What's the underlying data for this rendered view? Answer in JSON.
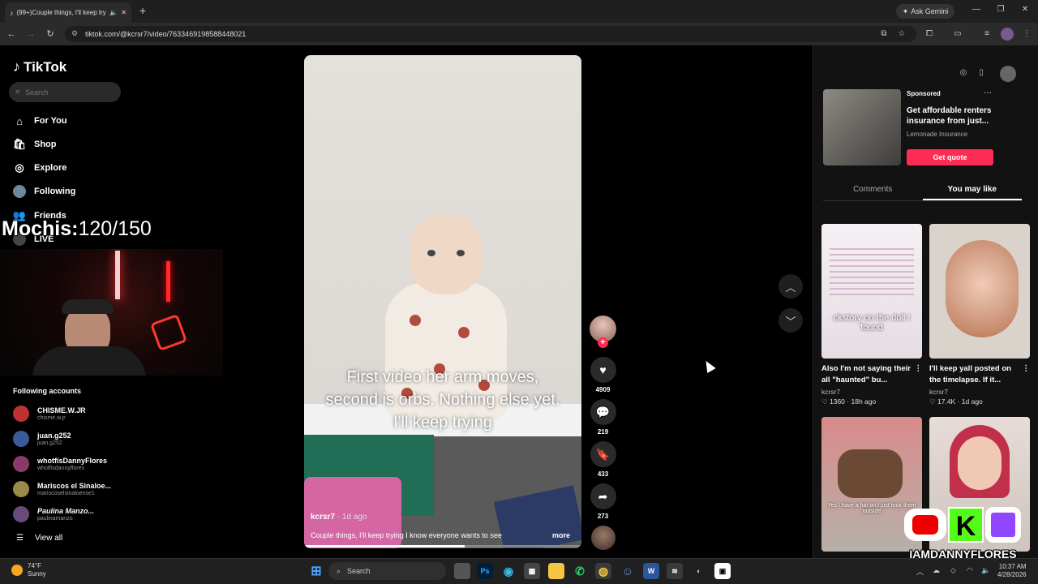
{
  "browser": {
    "tab_title": "(99+)Couple things, I'll keep trying",
    "ask_gemini": "Ask Gemini",
    "url": "tiktok.com/@kcrsr7/video/7633469198588448021"
  },
  "sidebar": {
    "logo": "TikTok",
    "search_placeholder": "Search",
    "nav": [
      {
        "label": "For You",
        "icon": "home-icon"
      },
      {
        "label": "Shop",
        "icon": "shop-icon"
      },
      {
        "label": "Explore",
        "icon": "compass-icon"
      },
      {
        "label": "Following",
        "icon": "following-avatar-icon"
      },
      {
        "label": "Friends",
        "icon": "friends-icon"
      },
      {
        "label": "LIVE",
        "icon": "live-icon"
      }
    ],
    "following_title": "Following accounts",
    "accounts": [
      {
        "name": "CHISME.W.JR",
        "handle": "chisme.w.jr"
      },
      {
        "name": "juan.g252",
        "handle": "juan.g252"
      },
      {
        "name": "whotfisDannyFlores",
        "handle": "whotfisdannyflores"
      },
      {
        "name": "Mariscos el Sinaloe...",
        "handle": "mariscoselsinaloense1"
      },
      {
        "name": "Paulina Manzo...",
        "handle": "paulinamanzo"
      }
    ],
    "view_all": "View all"
  },
  "overlay": {
    "mochis_label": "Mochis:",
    "mochis_value": "120/150",
    "social_tag": "IAMDANNYFLORES"
  },
  "video": {
    "caption_overlay": "First video her arm moves, second is orbs. Nothing else yet. I'll keep trying",
    "author": "kcrsr7",
    "age": " · 1d ago",
    "description": "Couple things, I'll keep trying I know everyone wants to see",
    "more": "more",
    "progress": 0.58
  },
  "actions": {
    "likes": "4909",
    "comments": "219",
    "saves": "433",
    "shares": "273"
  },
  "ad": {
    "sponsored": "Sponsored",
    "title": "Get affordable renters insurance from just...",
    "brand": "Lemonade Insurance",
    "button": "Get quote"
  },
  "tabs": {
    "comments": "Comments",
    "you_may_like": "You may like"
  },
  "recommendations": [
    {
      "overlay": "ckstory on the doll I found",
      "title": "Also I'm not saying their all \"haunted\" bu...",
      "user": "kcrsr7",
      "likes": "1360",
      "age": "18h ago"
    },
    {
      "overlay": "",
      "title": "I'll keep yall posted on the timelapse. If it...",
      "user": "kcrsr7",
      "likes": "17.4K",
      "age": "1d ago"
    },
    {
      "overlay": "Yes I have a hat on I just took them outside",
      "title": "",
      "user": "",
      "likes": "",
      "age": ""
    },
    {
      "overlay": "",
      "title": "",
      "user": "",
      "likes": "",
      "age": ""
    }
  ],
  "taskbar": {
    "temp": "74°F",
    "weather": "Sunny",
    "search": "Search",
    "time": "10:37 AM",
    "date": "4/28/2026"
  },
  "colors": {
    "accent": "#fe2c55",
    "background": "#000000",
    "panel": "#121212"
  }
}
